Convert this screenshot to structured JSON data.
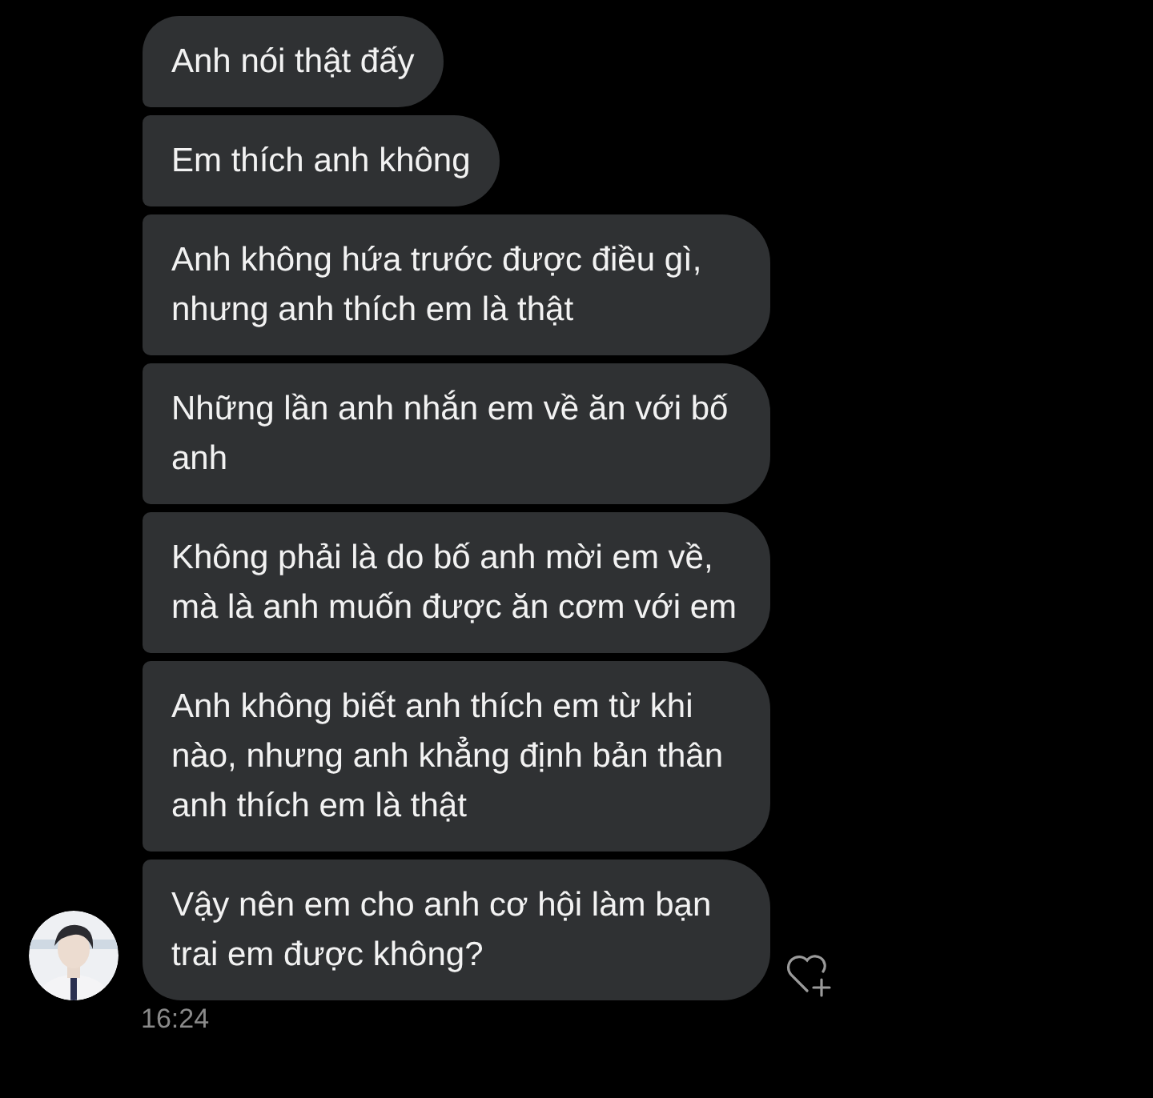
{
  "messages": [
    {
      "text": "Anh nói thật đấy"
    },
    {
      "text": "Em thích anh không"
    },
    {
      "text": "Anh không hứa trước được điều gì, nhưng anh thích em là thật"
    },
    {
      "text": "Những lần anh nhắn em về ăn với bố anh"
    },
    {
      "text": "Không phải là do bố anh mời em về, mà là anh muốn được ăn cơm với em"
    },
    {
      "text": "Anh không biết anh thích em từ khi nào, nhưng anh khẳng định bản thân anh thích em là thật"
    },
    {
      "text": "Vậy nên em cho anh cơ hội làm bạn trai em được không?"
    }
  ],
  "timestamp": "16:24"
}
